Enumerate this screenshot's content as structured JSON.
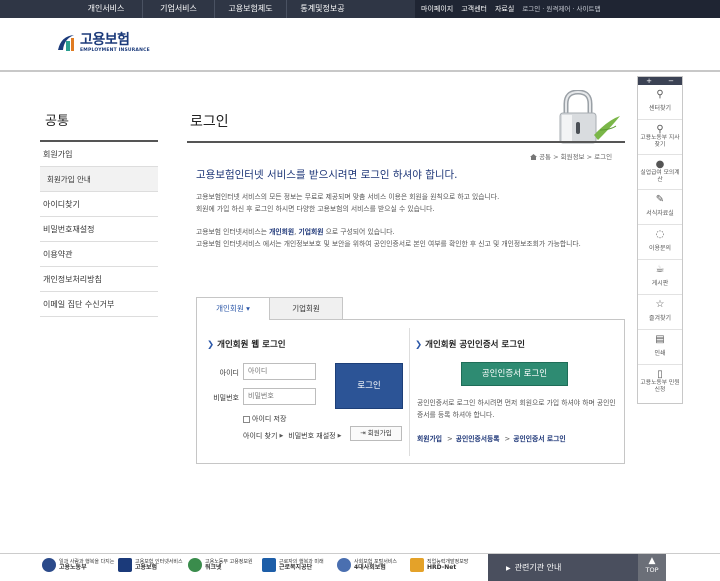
{
  "topnav": {
    "menu": [
      "개인서비스",
      "기업서비스",
      "고용보험제도",
      "통계및정보공개"
    ],
    "util": [
      "마이페이지",
      "고객센터",
      "자료실"
    ],
    "util_small": "로그인 · 원격제어 · 사이트맵"
  },
  "logo": {
    "ko": "고용보험",
    "en": "EMPLOYMENT INSURANCE"
  },
  "sidebar": {
    "title": "공통",
    "items": [
      {
        "label": "회원가입"
      },
      {
        "label": "회원가입 안내"
      },
      {
        "label": "아이디찾기"
      },
      {
        "label": "비밀번호재설정"
      },
      {
        "label": "이용약관"
      },
      {
        "label": "개인정보처리방침"
      },
      {
        "label": "이메일 집단 수신거부"
      }
    ]
  },
  "page": {
    "title": "로그인",
    "breadcrumb": "공통 > 회원정보 > 로그인",
    "headline": "고용보험인터넷 서비스를 받으시려면 로그인 하셔야 합니다.",
    "para1": [
      "고용보험인터넷 서비스의 모든 정보는 무료로 제공되며 맞춤 서비스 이용은 회원을 원칙으로 하고 있습니다.",
      "회원에 가입 하신 후 로그인 하시면 다양한 고용보험의 서비스를 받으실 수 있습니다."
    ],
    "para2_prefix": "고용보험 인터넷서비스는 ",
    "para2_bold1": "개인회원",
    "para2_mid": ", ",
    "para2_bold2": "기업회원",
    "para2_suffix": " 으로 구성되어 있습니다.",
    "para3": "고용보험 인터넷서비스 에서는 개인정보보호 및 보안을 위하여 공인인증서로 본인 여부를 확인한 후 신고 및 개인정보조회가 가능합니다."
  },
  "tabs": [
    {
      "label": "개인회원 ▾",
      "active": true
    },
    {
      "label": "기업회원",
      "active": false
    }
  ],
  "web_login": {
    "title": "개인회원 웹 로그인",
    "id_label": "아이디",
    "id_placeholder": "아이디",
    "pw_label": "비밀번호",
    "pw_placeholder": "비밀번호",
    "login_button": "로그인",
    "remember_label": "아이디 저장",
    "find_id": "아이디 찾기",
    "reset_pw": "비밀번호 재설정",
    "join": "회원가입"
  },
  "cert_login": {
    "title": "개인회원 공인인증서 로그인",
    "button": "공인인증서 로그인",
    "desc": "공인인증서로 로그인 하시려면 먼저 회원으로 가입 하셔야 하며 공인인증서를 등록 하셔야 합니다.",
    "links": [
      "회원가입",
      "공인인증서등록",
      "공인인증서 로그인"
    ]
  },
  "quick_menu": {
    "header": [
      "+",
      "−"
    ],
    "items": [
      {
        "label": "센터찾기",
        "icon": "location-pin-icon"
      },
      {
        "label": "고용노동부 지사찾기",
        "icon": "location-pin-icon"
      },
      {
        "label": "실업급여 모의계산",
        "icon": "person-icon"
      },
      {
        "label": "서식자료실",
        "icon": "edit-icon"
      },
      {
        "label": "이용문의",
        "icon": "chat-icon"
      },
      {
        "label": "게시판",
        "icon": "coffee-icon"
      },
      {
        "label": "즐겨찾기",
        "icon": "star-icon"
      },
      {
        "label": "인쇄",
        "icon": "print-icon"
      },
      {
        "label": "고용노동부 민원신청",
        "icon": "document-icon"
      }
    ]
  },
  "footer": {
    "orgs": [
      {
        "small": "일과 사람과 행복을 다지는",
        "name": "고용노동부"
      },
      {
        "small": "고용보험 인터넷서비스",
        "name": "고용보험"
      },
      {
        "small": "고용노동부 고용정보원",
        "name": "워크넷"
      },
      {
        "small": "근로자의 행복과 미래",
        "name": "근로복지공단"
      },
      {
        "small": "사회보험 포털서비스",
        "name": "4대사회보험"
      },
      {
        "small": "직업능력개발정보망",
        "name": "HRD-Net"
      }
    ],
    "related": "관련기관 안내",
    "top": "TOP"
  },
  "colors": {
    "nav_bg": "#2f3645",
    "brand_blue": "#1c3577",
    "login_btn": "#2c5496",
    "cert_btn": "#2e8b72"
  }
}
